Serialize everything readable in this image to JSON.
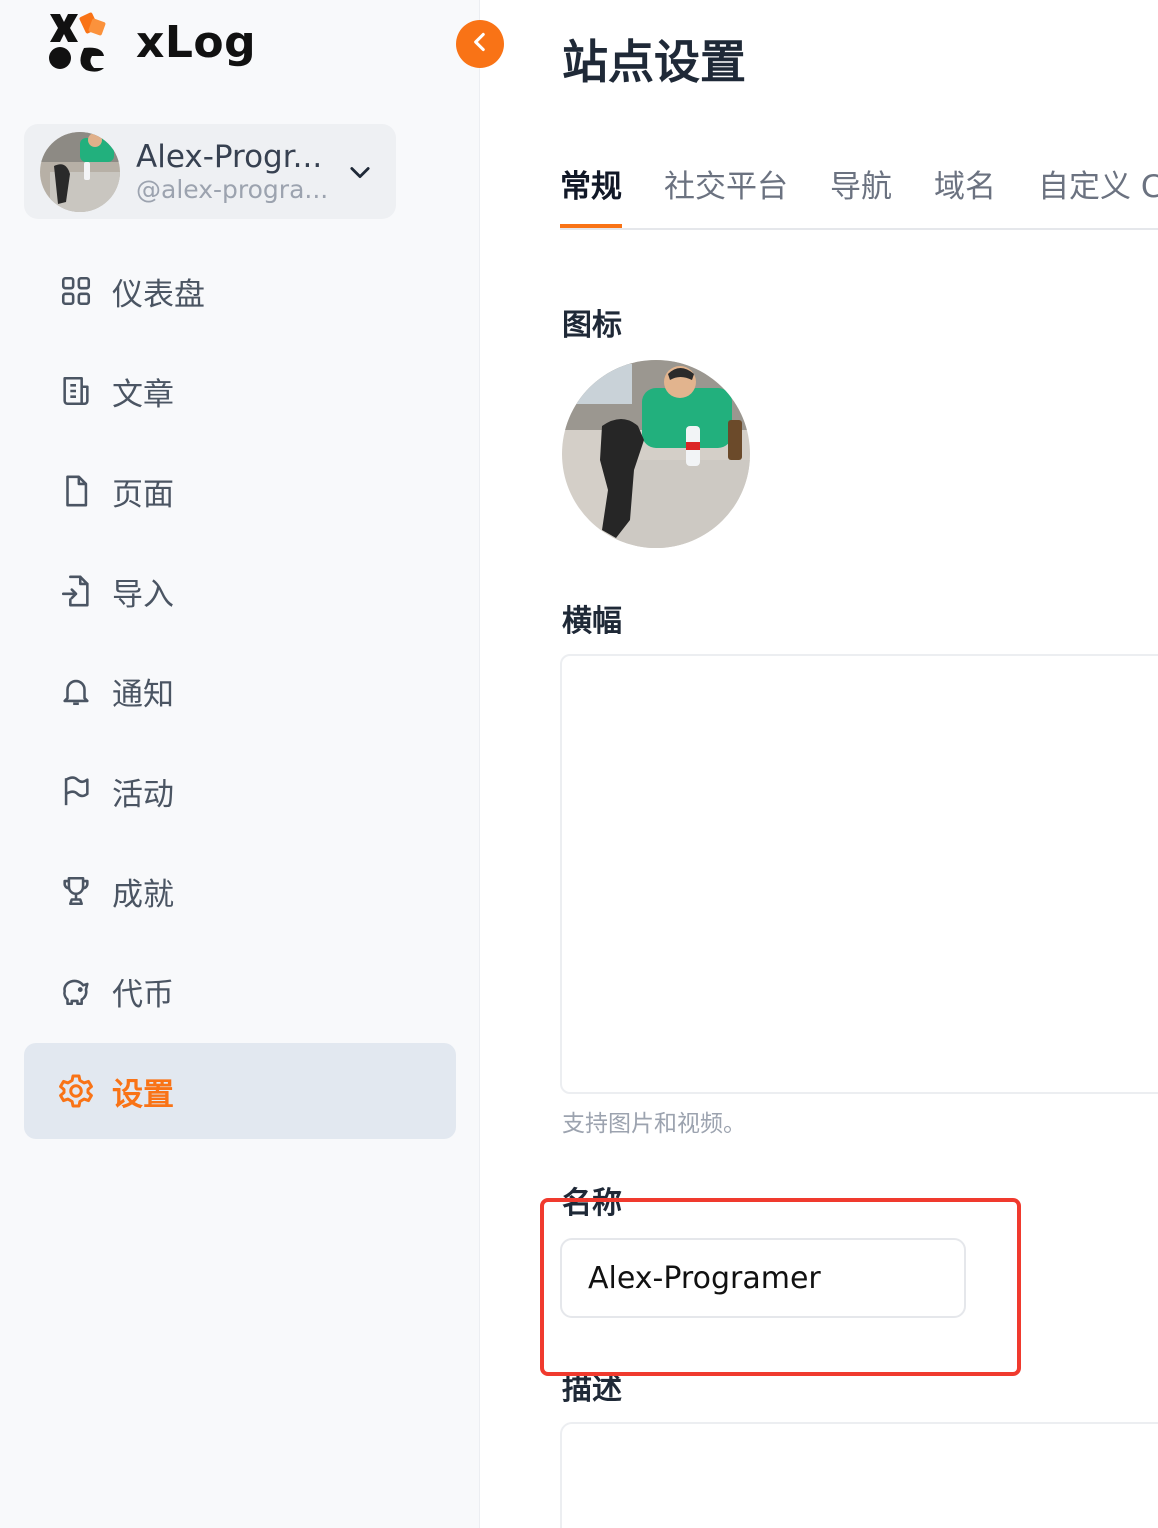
{
  "app": {
    "logo_text": "xLog"
  },
  "account": {
    "name": "Alex-Progr...",
    "handle": "@alex-progra..."
  },
  "nav": [
    {
      "icon": "dashboard-grid-icon",
      "label": "仪表盘"
    },
    {
      "icon": "document-icon",
      "label": "文章"
    },
    {
      "icon": "file-icon",
      "label": "页面"
    },
    {
      "icon": "import-icon",
      "label": "导入"
    },
    {
      "icon": "bell-icon",
      "label": "通知"
    },
    {
      "icon": "flag-icon",
      "label": "活动"
    },
    {
      "icon": "trophy-icon",
      "label": "成就"
    },
    {
      "icon": "piggy-bank-icon",
      "label": "代币"
    },
    {
      "icon": "gear-icon",
      "label": "设置"
    }
  ],
  "page": {
    "title": "站点设置",
    "tabs": [
      "常规",
      "社交平台",
      "导航",
      "域名",
      "自定义 C"
    ],
    "active_tab": "常规",
    "icon_label": "图标",
    "banner_label": "横幅",
    "banner_hint": "支持图片和视频。",
    "name_label": "名称",
    "name_value": "Alex-Programer",
    "description_label": "描述"
  },
  "colors": {
    "accent": "#f97316",
    "highlight": "#f03a2e",
    "active_nav_bg": "#e2e8f0"
  }
}
